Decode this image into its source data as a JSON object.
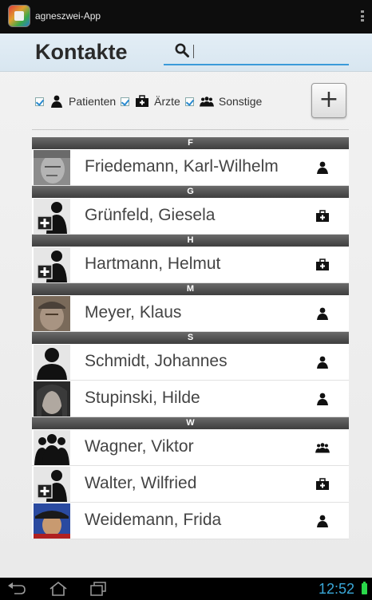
{
  "app": {
    "title": "agneszwei-App"
  },
  "header": {
    "title": "Kontakte",
    "search_value": "",
    "search_placeholder": ""
  },
  "filters": [
    {
      "label": "Patienten",
      "checked": true,
      "icon": "person-icon"
    },
    {
      "label": "Ärzte",
      "checked": true,
      "icon": "doctor-bag-icon"
    },
    {
      "label": "Sonstige",
      "checked": true,
      "icon": "group-icon"
    }
  ],
  "add_button_label": "+",
  "contacts": [
    {
      "section": "F",
      "name": "Friedemann, Karl-Wilhelm",
      "type": "patient"
    },
    {
      "section": "G",
      "name": "Grünfeld, Giesela",
      "type": "doctor"
    },
    {
      "section": "H",
      "name": "Hartmann, Helmut",
      "type": "doctor"
    },
    {
      "section": "M",
      "name": "Meyer, Klaus",
      "type": "patient"
    },
    {
      "section": "S",
      "name": "Schmidt, Johannes",
      "type": "patient"
    },
    {
      "section": "",
      "name": "Stupinski, Hilde",
      "type": "patient"
    },
    {
      "section": "W",
      "name": "Wagner, Viktor",
      "type": "other"
    },
    {
      "section": "",
      "name": "Walter, Wilfried",
      "type": "doctor"
    },
    {
      "section": "",
      "name": "Weidemann, Frida",
      "type": "patient"
    }
  ],
  "sections": {
    "F": "F",
    "G": "G",
    "H": "H",
    "M": "M",
    "S": "S",
    "W": "W"
  },
  "statusbar": {
    "time": "12:52"
  },
  "colors": {
    "accent": "#3a9ad9",
    "section_bar": "#4a4a4a",
    "clock": "#3aa8d8",
    "battery": "#2ad84a"
  }
}
